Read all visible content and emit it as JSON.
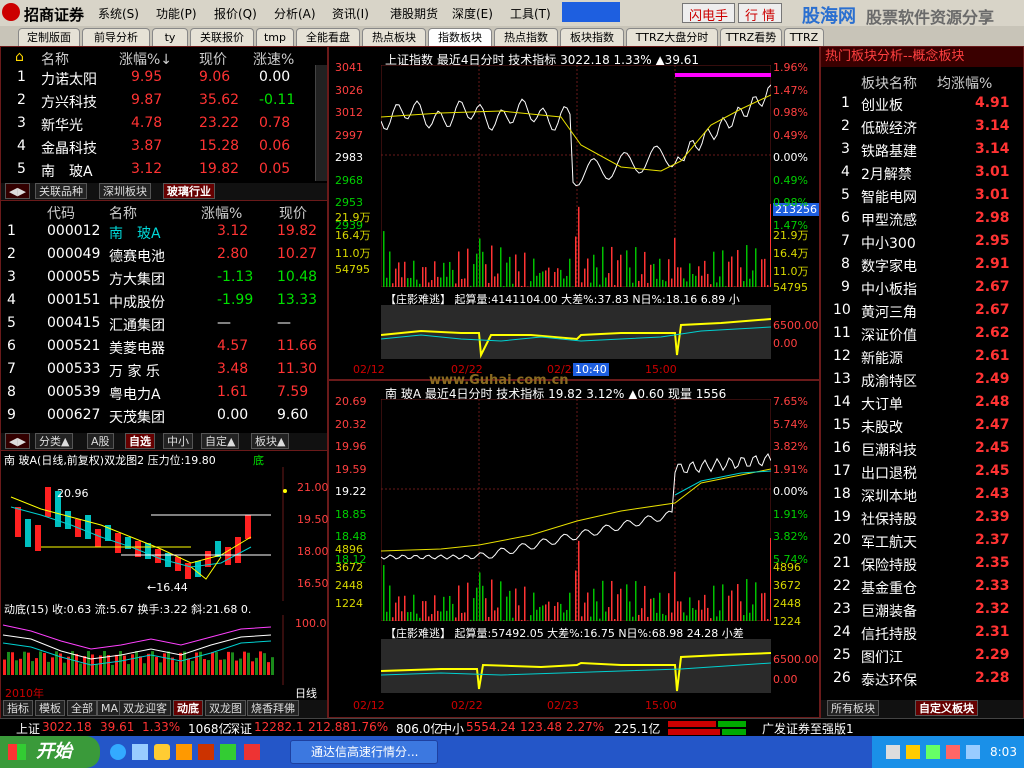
{
  "menu": {
    "brand": "招商证券",
    "items": [
      "系统(S)",
      "功能(P)",
      "报价(Q)",
      "分析(A)",
      "资讯(I)",
      "港股期货",
      "深度(E)",
      "工具(T)"
    ],
    "flash_btn": "闪电手",
    "quote_btn": "行 情",
    "top_right_logo": "股海网",
    "top_right_text": "股票软件资源分享",
    "top_right_url": "www.Guhai.com.cn"
  },
  "tabs": [
    "定制版面",
    "前导分析",
    "ty",
    "关联报价",
    "tmp",
    "全能看盘",
    "热点板块",
    "指数板块",
    "热点指数",
    "板块指数",
    "TTRZ大盘分时",
    "TTRZ看势",
    "TTRZ机器"
  ],
  "active_tab": "指数板块",
  "top_list": {
    "headers": [
      "名称",
      "涨幅%↓",
      "现价",
      "涨速%"
    ],
    "rows": [
      {
        "n": "1",
        "name": "力诺太阳",
        "chg": "9.95",
        "price": "9.06",
        "speed": "0.00"
      },
      {
        "n": "2",
        "name": "方兴科技",
        "chg": "9.87",
        "price": "35.62",
        "speed": "-0.11"
      },
      {
        "n": "3",
        "name": "新华光",
        "chg": "4.78",
        "price": "23.22",
        "speed": "0.78"
      },
      {
        "n": "4",
        "name": "金晶科技",
        "chg": "3.87",
        "price": "15.28",
        "speed": "0.06"
      },
      {
        "n": "5",
        "name": "南　玻A",
        "chg": "3.12",
        "price": "19.82",
        "speed": "0.05"
      }
    ],
    "subtabs": [
      "关联品种",
      "深圳板块",
      "玻璃行业"
    ]
  },
  "mid_list": {
    "headers": [
      "代码",
      "名称",
      "涨幅%",
      "现价"
    ],
    "rows": [
      {
        "n": "1",
        "code": "000012",
        "name": "南　玻A",
        "chg": "3.12",
        "price": "19.82"
      },
      {
        "n": "2",
        "code": "000049",
        "name": "德赛电池",
        "chg": "2.80",
        "price": "10.27"
      },
      {
        "n": "3",
        "code": "000055",
        "name": "方大集团",
        "chg": "-1.13",
        "price": "10.48"
      },
      {
        "n": "4",
        "code": "000151",
        "name": "中成股份",
        "chg": "-1.99",
        "price": "13.33"
      },
      {
        "n": "5",
        "code": "000415",
        "name": "汇通集团",
        "chg": "—",
        "price": "—"
      },
      {
        "n": "6",
        "code": "000521",
        "name": "美菱电器",
        "chg": "4.57",
        "price": "11.66"
      },
      {
        "n": "7",
        "code": "000533",
        "name": "万 家 乐",
        "chg": "3.48",
        "price": "11.30"
      },
      {
        "n": "8",
        "code": "000539",
        "name": "粤电力A",
        "chg": "1.61",
        "price": "7.59"
      },
      {
        "n": "9",
        "code": "000627",
        "name": "天茂集团",
        "chg": "0.00",
        "price": "9.60"
      }
    ],
    "subtabs": [
      "分类▲",
      "A股",
      "自选",
      "中小",
      "自定▲",
      "板块▲"
    ]
  },
  "kline": {
    "title": "南 玻A(日线,前复权)双龙图2  压力位:19.80",
    "title_tag": "底",
    "high_label": "20.96",
    "low_label": "←16.44",
    "axis": [
      "21.00",
      "19.50",
      "18.00",
      "16.50"
    ],
    "ind_title": "动底(15) 收:0.63 流:5.67 换手:3.22 斜:21.68  0.",
    "ind_axis": "100.0",
    "year": "2010年",
    "period": "日线",
    "bottom_tabs": [
      "指标",
      "模板",
      "全部",
      "MA",
      "双龙迎客",
      "动底",
      "双龙图",
      "烧香拜佛"
    ]
  },
  "index_chart": {
    "header": "上证指数  最近4日分时 技术指标  3022.18  1.33%  ▲39.61",
    "left_axis": [
      "3041",
      "3026",
      "3012",
      "2997",
      "2983",
      "2968",
      "2953",
      "2939"
    ],
    "right_axis": [
      "1.96%",
      "1.47%",
      "0.98%",
      "0.49%",
      "0.00%",
      "0.49%",
      "0.98%",
      "1.47%"
    ],
    "vol_left": [
      "21.9万",
      "16.4万",
      "11.0万",
      "54795"
    ],
    "vol_right": [
      "21.9万",
      "16.4万",
      "11.0万",
      "54795"
    ],
    "cursor_value": "213256",
    "ind_header": "【庄影难逃】 起算量:4141104.00  大差%:37.83  N日%:18.16  6.89 小",
    "ind_right": [
      "6500.00",
      "0.00"
    ],
    "dates": [
      "02/12",
      "02/22",
      "02/23",
      "10:40",
      "15:00"
    ]
  },
  "stock_chart": {
    "header": "南  玻A  最近4日分时 技术指标  19.82  3.12%  ▲0.60  现量 1556",
    "left_axis": [
      "20.69",
      "20.32",
      "19.96",
      "19.59",
      "19.22",
      "18.85",
      "18.48",
      "18.12"
    ],
    "right_axis": [
      "7.65%",
      "5.74%",
      "3.82%",
      "1.91%",
      "0.00%",
      "1.91%",
      "3.82%",
      "5.74%"
    ],
    "vol_left": [
      "4896",
      "3672",
      "2448",
      "1224"
    ],
    "vol_right": [
      "4896",
      "3672",
      "2448",
      "1224"
    ],
    "ind_header": "【庄影难逃】 起算量:57492.05  大差%:16.75  N日%:68.98  24.28 小差",
    "ind_right": [
      "6500.00",
      "0.00"
    ],
    "dates": [
      "02/12",
      "02/22",
      "02/23",
      "15:00"
    ],
    "watermark": "www.Guhai.com.cn"
  },
  "sector_list": {
    "title": "热门板块分析--概念板块",
    "headers": [
      "板块名称",
      "均涨幅%"
    ],
    "rows": [
      [
        "1",
        "创业板",
        "4.91"
      ],
      [
        "2",
        "低碳经济",
        "3.14"
      ],
      [
        "3",
        "铁路基建",
        "3.14"
      ],
      [
        "4",
        "2月解禁",
        "3.01"
      ],
      [
        "5",
        "智能电网",
        "3.01"
      ],
      [
        "6",
        "甲型流感",
        "2.98"
      ],
      [
        "7",
        "中小300",
        "2.95"
      ],
      [
        "8",
        "数字家电",
        "2.91"
      ],
      [
        "9",
        "中小板指",
        "2.67"
      ],
      [
        "10",
        "黄河三角",
        "2.67"
      ],
      [
        "11",
        "深证价值",
        "2.62"
      ],
      [
        "12",
        "新能源",
        "2.61"
      ],
      [
        "13",
        "成渝特区",
        "2.49"
      ],
      [
        "14",
        "大订单",
        "2.48"
      ],
      [
        "15",
        "未股改",
        "2.47"
      ],
      [
        "16",
        "巨潮科技",
        "2.45"
      ],
      [
        "17",
        "出口退税",
        "2.45"
      ],
      [
        "18",
        "深圳本地",
        "2.43"
      ],
      [
        "19",
        "社保持股",
        "2.39"
      ],
      [
        "20",
        "军工航天",
        "2.37"
      ],
      [
        "21",
        "保险持股",
        "2.35"
      ],
      [
        "22",
        "基金重仓",
        "2.33"
      ],
      [
        "23",
        "巨潮装备",
        "2.32"
      ],
      [
        "24",
        "信托持股",
        "2.31"
      ],
      [
        "25",
        "图们江",
        "2.29"
      ],
      [
        "26",
        "泰达环保",
        "2.28"
      ]
    ],
    "tabs": [
      "所有板块",
      "自定义板块"
    ]
  },
  "status": {
    "sh_label": "上证",
    "sh_value": "3022.18",
    "sh_chg": "39.61",
    "sh_pct": "1.33%",
    "sh_amt": "1068亿",
    "sz_label": "深证",
    "sz_value": "12282.1",
    "sz_chg": "212.88",
    "sz_pct": "1.76%",
    "sz_amt": "806.0亿",
    "zx_label": "中小",
    "zx_value": "5554.24",
    "zx_chg": "123.48",
    "zx_pct": "2.27%",
    "zx_amt": "225.1亿",
    "broker": "广发证券至强版1"
  },
  "taskbar": {
    "start": "开始",
    "task": "通达信高速行情分...",
    "clock": "8:03"
  },
  "colors": {
    "up": "#ff3333",
    "down": "#00e000",
    "accent": "#ffd800",
    "bg": "#000000"
  }
}
